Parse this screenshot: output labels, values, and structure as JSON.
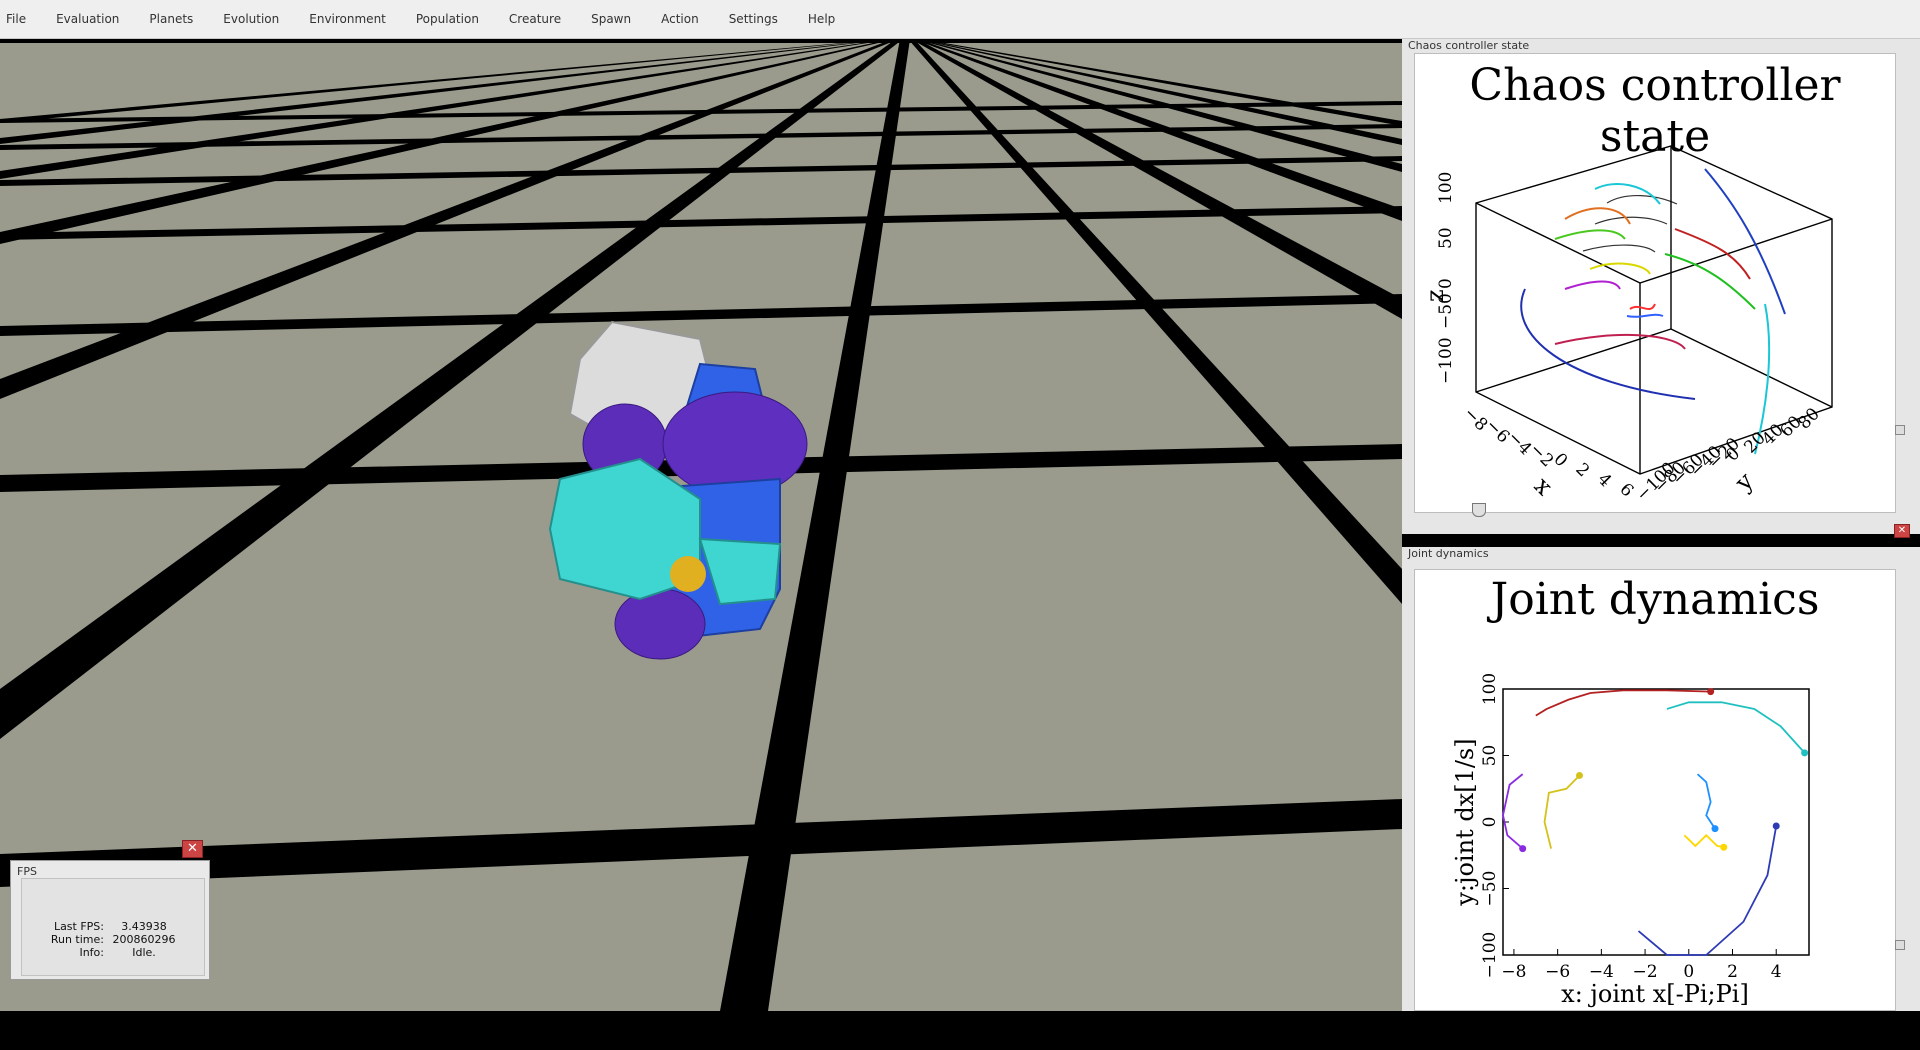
{
  "menubar": {
    "items": [
      "File",
      "Evaluation",
      "Planets",
      "Evolution",
      "Environment",
      "Population",
      "Creature",
      "Spawn",
      "Action",
      "Settings",
      "Help"
    ]
  },
  "chaos_panel": {
    "window_title": "Chaos controller state",
    "plot_title": "Chaos controller state",
    "axis_x_label": "x",
    "axis_y_label": "y",
    "axis_z_label": "z",
    "x_ticks": [
      "−8",
      "−6",
      "−4",
      "−2",
      "0",
      "2",
      "4",
      "6"
    ],
    "y_ticks": [
      "−100",
      "−80",
      "−60",
      "−40",
      "−20",
      "0",
      "20",
      "40",
      "60",
      "80"
    ],
    "z_ticks": [
      "100",
      "50",
      "0",
      "−50",
      "−100"
    ]
  },
  "joint_panel": {
    "window_title": "Joint dynamics",
    "plot_title": "Joint dynamics",
    "xlabel": "x: joint x[-Pi;Pi]",
    "ylabel": "y:joint dx[1/s]"
  },
  "chart_data": {
    "type": "line",
    "title": "Joint dynamics",
    "xlabel": "x: joint x[-Pi;Pi]",
    "ylabel": "y:joint dx[1/s]",
    "xlim": [
      -8.5,
      5.5
    ],
    "ylim": [
      -100,
      100
    ],
    "x_ticks": [
      -8,
      -6,
      -4,
      -2,
      0,
      2,
      4
    ],
    "y_ticks": [
      -100,
      -50,
      0,
      50,
      100
    ],
    "grid": false,
    "series": [
      {
        "color": "#b22222",
        "x": [
          -7,
          -6.5,
          -5.5,
          -4.5,
          -3,
          -1,
          1
        ],
        "y": [
          80,
          85,
          92,
          97,
          99,
          99,
          98
        ]
      },
      {
        "color": "#20c0c0",
        "x": [
          -1,
          0,
          1.5,
          3,
          4.2,
          5.3
        ],
        "y": [
          85,
          90,
          90,
          85,
          72,
          52
        ]
      },
      {
        "color": "#8a2be2",
        "x": [
          -7.6,
          -8.2,
          -8.5,
          -8.3,
          -7.6
        ],
        "y": [
          36,
          28,
          5,
          -10,
          -20
        ]
      },
      {
        "color": "#d4c21a",
        "x": [
          -6.3,
          -6.6,
          -6.4,
          -5.6,
          -5
        ],
        "y": [
          -20,
          0,
          22,
          25,
          35
        ]
      },
      {
        "color": "#1e90ff",
        "x": [
          0.4,
          0.8,
          1,
          0.8,
          1.2
        ],
        "y": [
          36,
          30,
          15,
          5,
          -5
        ]
      },
      {
        "color": "#ffd700",
        "x": [
          -0.2,
          0.3,
          0.8,
          1.3,
          1.6
        ],
        "y": [
          -10,
          -18,
          -10,
          -18,
          -19
        ]
      },
      {
        "color": "#2e3bb5",
        "x": [
          -2.3,
          -1,
          0.8,
          2.5,
          3.6,
          4
        ],
        "y": [
          -82,
          -100,
          -100,
          -75,
          -40,
          -3
        ]
      }
    ]
  }
}
